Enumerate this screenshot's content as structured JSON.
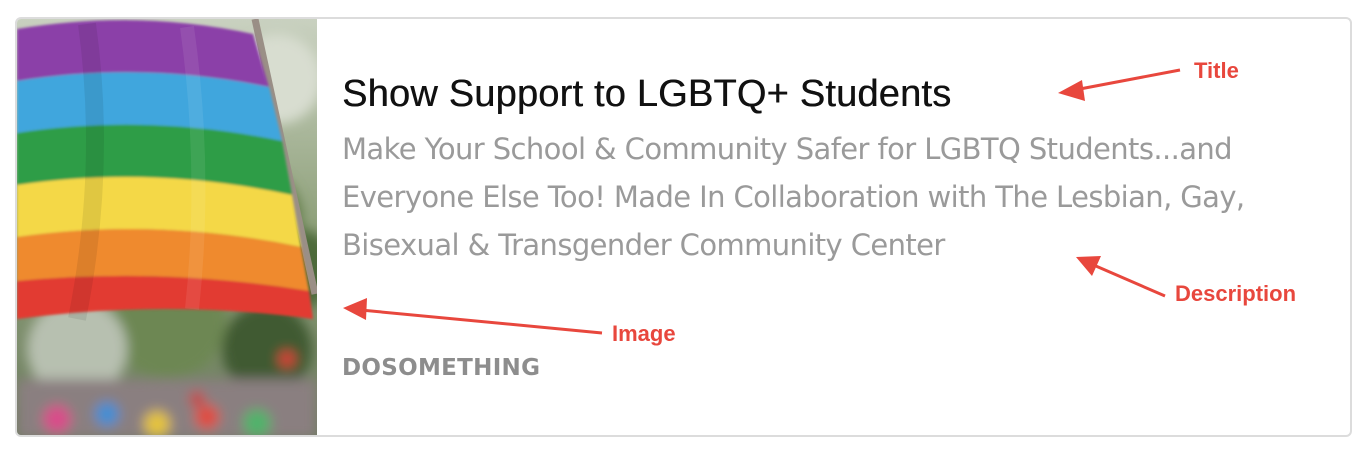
{
  "card": {
    "title": "Show Support to LGBTQ+ Students",
    "description": "Make Your School & Community Safer for LGBTQ Students...and Everyone Else Too! Made In Collaboration with The Lesbian, Gay, Bisexual & Transgender Community Center",
    "site_name": "DOSOMETHING",
    "image": {
      "depicts": "rainbow-pride-flag-photo",
      "stripe_colors": [
        "#8b3fa8",
        "#3fa6dd",
        "#2f9d46",
        "#f4d847",
        "#ef8a2e",
        "#e23a32"
      ]
    }
  },
  "annotations": {
    "title_label": "Title",
    "description_label": "Description",
    "image_label": "Image",
    "color": "#e8473d"
  }
}
